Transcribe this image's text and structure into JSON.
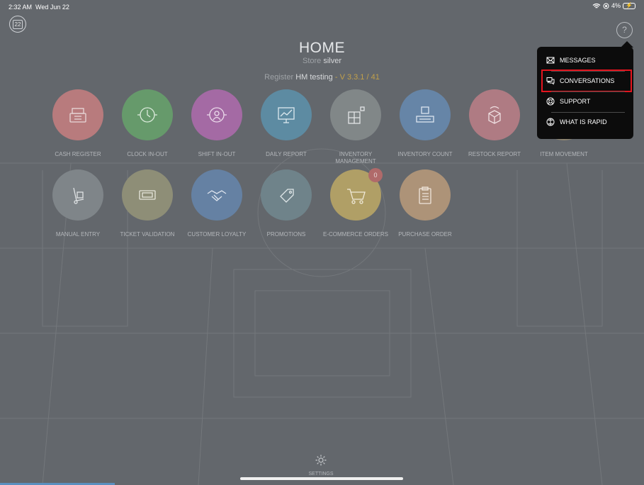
{
  "status_bar": {
    "time": "2:32 AM",
    "date": "Wed Jun 22",
    "battery_percent": "4%"
  },
  "calendar_day": "22",
  "header": {
    "title": "HOME",
    "store_prefix": "Store",
    "store_name": "silver"
  },
  "register": {
    "prefix": "Register",
    "name": "HM testing",
    "separator": " - ",
    "version": "V 3.3.1 / 41"
  },
  "help": {
    "label": "?"
  },
  "tiles": [
    {
      "label": "CASH REGISTER",
      "color": "#b87b7d"
    },
    {
      "label": "CLOCK IN-OUT",
      "color": "#669a6b"
    },
    {
      "label": "SHIFT IN-OUT",
      "color": "#a46aa4"
    },
    {
      "label": "DAILY REPORT",
      "color": "#5d8ba2"
    },
    {
      "label": "INVENTORY MANAGEMENT",
      "color": "#818788"
    },
    {
      "label": "INVENTORY COUNT",
      "color": "#6685a7"
    },
    {
      "label": "RESTOCK REPORT",
      "color": "#af7b83"
    },
    {
      "label": "ITEM MOVEMENT",
      "color": "#8d8470"
    },
    {
      "label": "MANUAL ENTRY",
      "color": "#7f8589"
    },
    {
      "label": "TICKET VALIDATION",
      "color": "#8e8e77"
    },
    {
      "label": "CUSTOMER LOYALTY",
      "color": "#6581a3"
    },
    {
      "label": "PROMOTIONS",
      "color": "#6f838a"
    },
    {
      "label": "E-COMMERCE ORDERS",
      "color": "#b09f66"
    },
    {
      "label": "PURCHASE ORDER",
      "color": "#ad9378"
    }
  ],
  "ecommerce_badge": "0",
  "settings": {
    "label": "SETTINGS"
  },
  "help_menu": {
    "items": [
      {
        "label": "MESSAGES",
        "icon": "envelope-icon"
      },
      {
        "label": "CONVERSATIONS",
        "icon": "chat-bubbles-icon",
        "highlighted": true
      },
      {
        "label": "SUPPORT",
        "icon": "lifebuoy-icon"
      },
      {
        "label": "WHAT IS RAPID",
        "icon": "info-icon"
      }
    ],
    "highlight_color": "#e4141e"
  }
}
